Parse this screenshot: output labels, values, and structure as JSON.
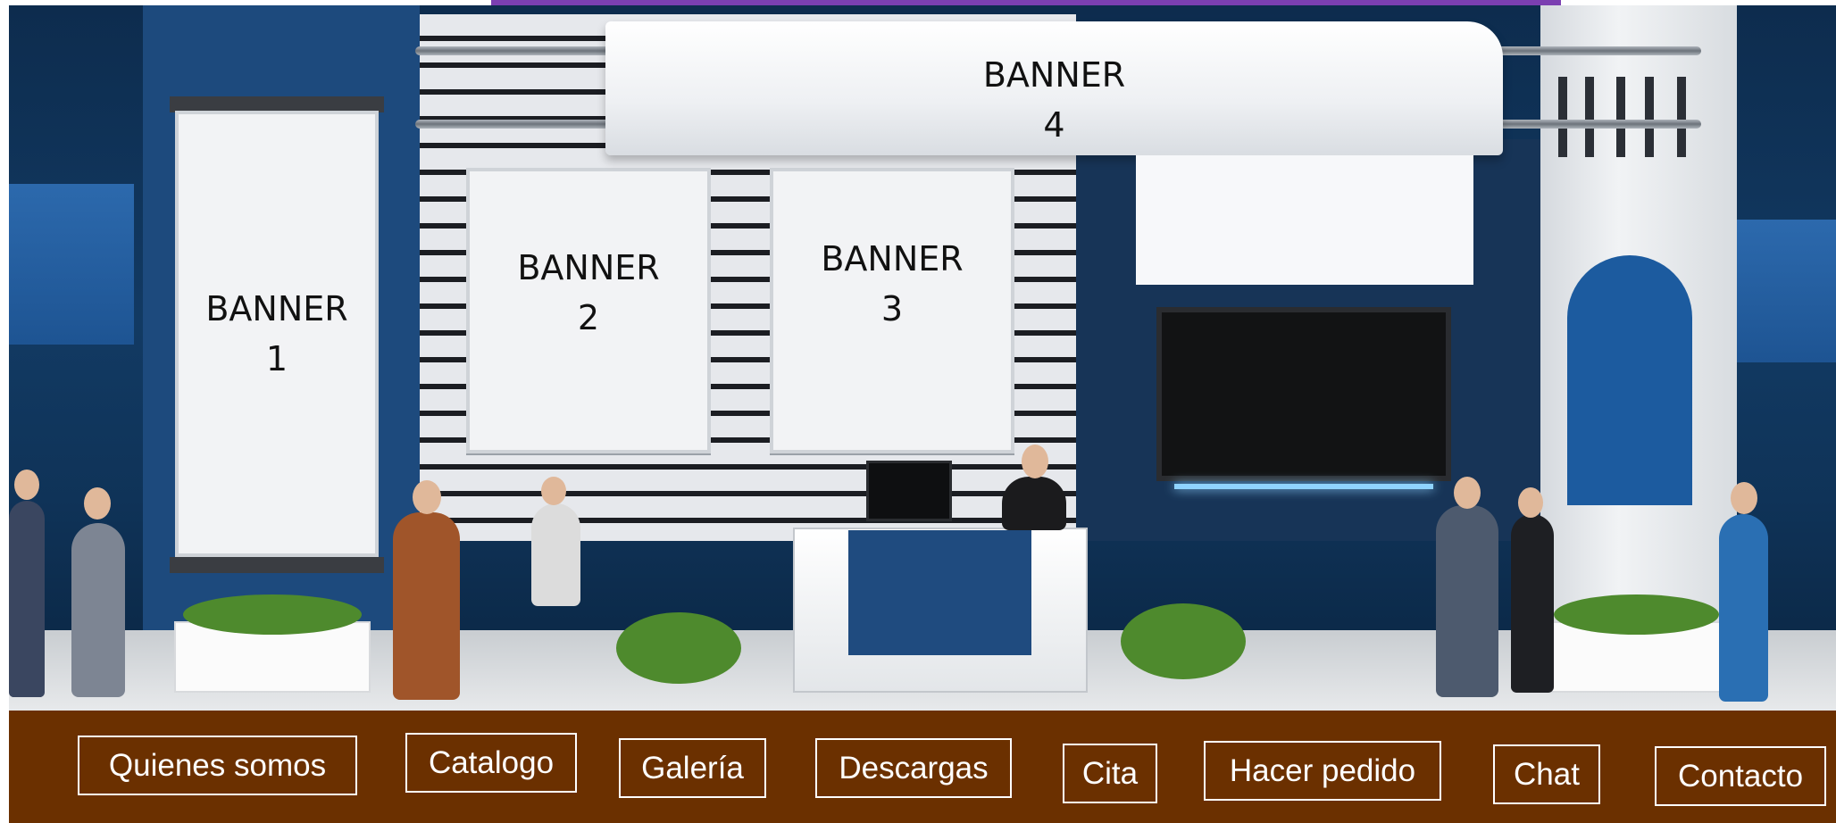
{
  "booth": {
    "banners": [
      {
        "line1": "BANNER",
        "line2": "1"
      },
      {
        "line1": "BANNER",
        "line2": "2"
      },
      {
        "line1": "BANNER",
        "line2": "3"
      },
      {
        "line1": "BANNER",
        "line2": "4"
      }
    ]
  },
  "navbar": {
    "items": [
      {
        "label": "Quienes somos"
      },
      {
        "label": "Catalogo"
      },
      {
        "label": "Galería"
      },
      {
        "label": "Descargas"
      },
      {
        "label": "Cita"
      },
      {
        "label": "Hacer pedido"
      },
      {
        "label": "Chat"
      },
      {
        "label": "Contacto"
      }
    ]
  },
  "colors": {
    "navbar_background": "#6b3000",
    "top_accent": "#7b3fb1",
    "booth_blue": "#1d4a7d"
  }
}
